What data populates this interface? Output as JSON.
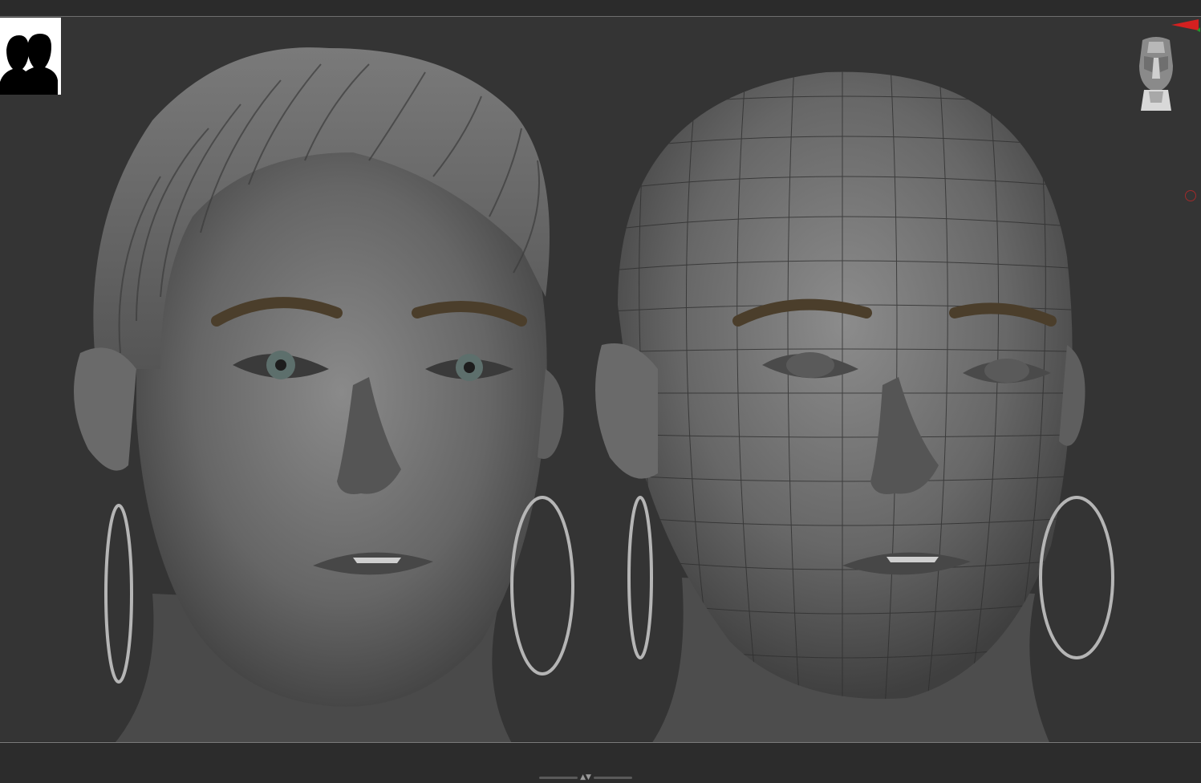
{
  "app": {
    "title": "",
    "viewport_background": "#343434",
    "accent": "#d42020"
  },
  "document_thumbnail": {
    "icon": "two-heads-silhouette-icon"
  },
  "navigation_gizmo": {
    "icon": "head-orientation-icon"
  },
  "models": [
    {
      "name": "sculpt-with-hair",
      "icon": "head-sculpt-icon",
      "wireframe": false
    },
    {
      "name": "sculpt-polyframe",
      "icon": "head-wireframe-icon",
      "wireframe": true
    }
  ]
}
